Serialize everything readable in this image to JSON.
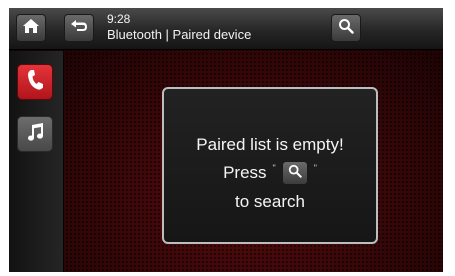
{
  "status": {
    "time": "9:28",
    "title": "Bluetooth | Paired device"
  },
  "toolbar": {
    "home_icon": "home-icon",
    "back_icon": "back-icon",
    "search_icon": "search-icon"
  },
  "sidebar": {
    "items": [
      {
        "icon": "phone-icon",
        "active": true,
        "color": "#d8262c"
      },
      {
        "icon": "music-note-icon",
        "active": false,
        "color": "#5c5c5c"
      }
    ]
  },
  "dialog": {
    "line1": "Paired list is empty!",
    "press": "Press",
    "open_quote": "\"",
    "close_quote": "\"",
    "line3": "to search"
  },
  "colors": {
    "accent": "#d8262c",
    "background": "#3a0708"
  }
}
